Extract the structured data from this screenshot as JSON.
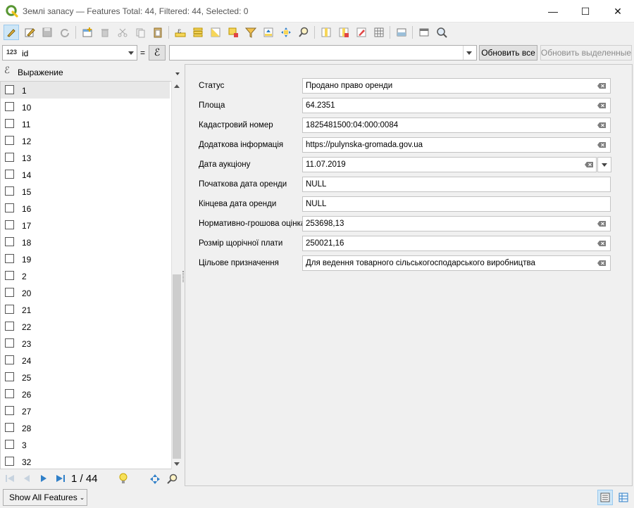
{
  "window": {
    "title": "Землі запасу — Features Total: 44, Filtered: 44, Selected: 0",
    "minimize": "—",
    "maximize": "☐",
    "close": "✕"
  },
  "filter": {
    "field_type": "123",
    "field_name": "id",
    "equals": "=",
    "expression_symbol": "ℰ",
    "value_placeholder": "",
    "update_all_label": "Обновить все",
    "update_selected_label": "Обновить выделенные"
  },
  "list": {
    "header": "Выражение",
    "items": [
      "1",
      "10",
      "11",
      "12",
      "13",
      "14",
      "15",
      "16",
      "17",
      "18",
      "19",
      "2",
      "20",
      "21",
      "22",
      "23",
      "24",
      "25",
      "26",
      "27",
      "28",
      "3",
      "32"
    ],
    "selected_index": 0
  },
  "form": {
    "fields": [
      {
        "label": "Статус",
        "value": "Продано право оренди",
        "clear": true
      },
      {
        "label": "Площа",
        "value": "64.2351",
        "clear": true
      },
      {
        "label": "Кадастровий номер",
        "value": "1825481500:04:000:0084",
        "clear": true
      },
      {
        "label": "Додаткова інформація",
        "value": "https://pulynska-gromada.gov.ua",
        "clear": true
      },
      {
        "label": "Дата аукціону",
        "value": "11.07.2019",
        "clear": true,
        "dropdown": true
      },
      {
        "label": "Початкова дата оренди",
        "value": "NULL",
        "clear": false
      },
      {
        "label": "Кінцева дата оренди",
        "value": "NULL",
        "clear": false
      },
      {
        "label": "Нормативно-грошова оцінка",
        "value": "253698,13",
        "clear": true
      },
      {
        "label": "Розмір щорічної плати",
        "value": "250021,16",
        "clear": true
      },
      {
        "label": "Цільове призначення",
        "value": "Для ведення товарного сільськогосподарського виробництва",
        "clear": true
      }
    ]
  },
  "navigation": {
    "position": "1 / 44"
  },
  "status": {
    "show_features_label": "Show All Features"
  },
  "colors": {
    "accent": "#2f7fc8",
    "qgis_green": "#589632",
    "qgis_yellow": "#f0c419"
  }
}
